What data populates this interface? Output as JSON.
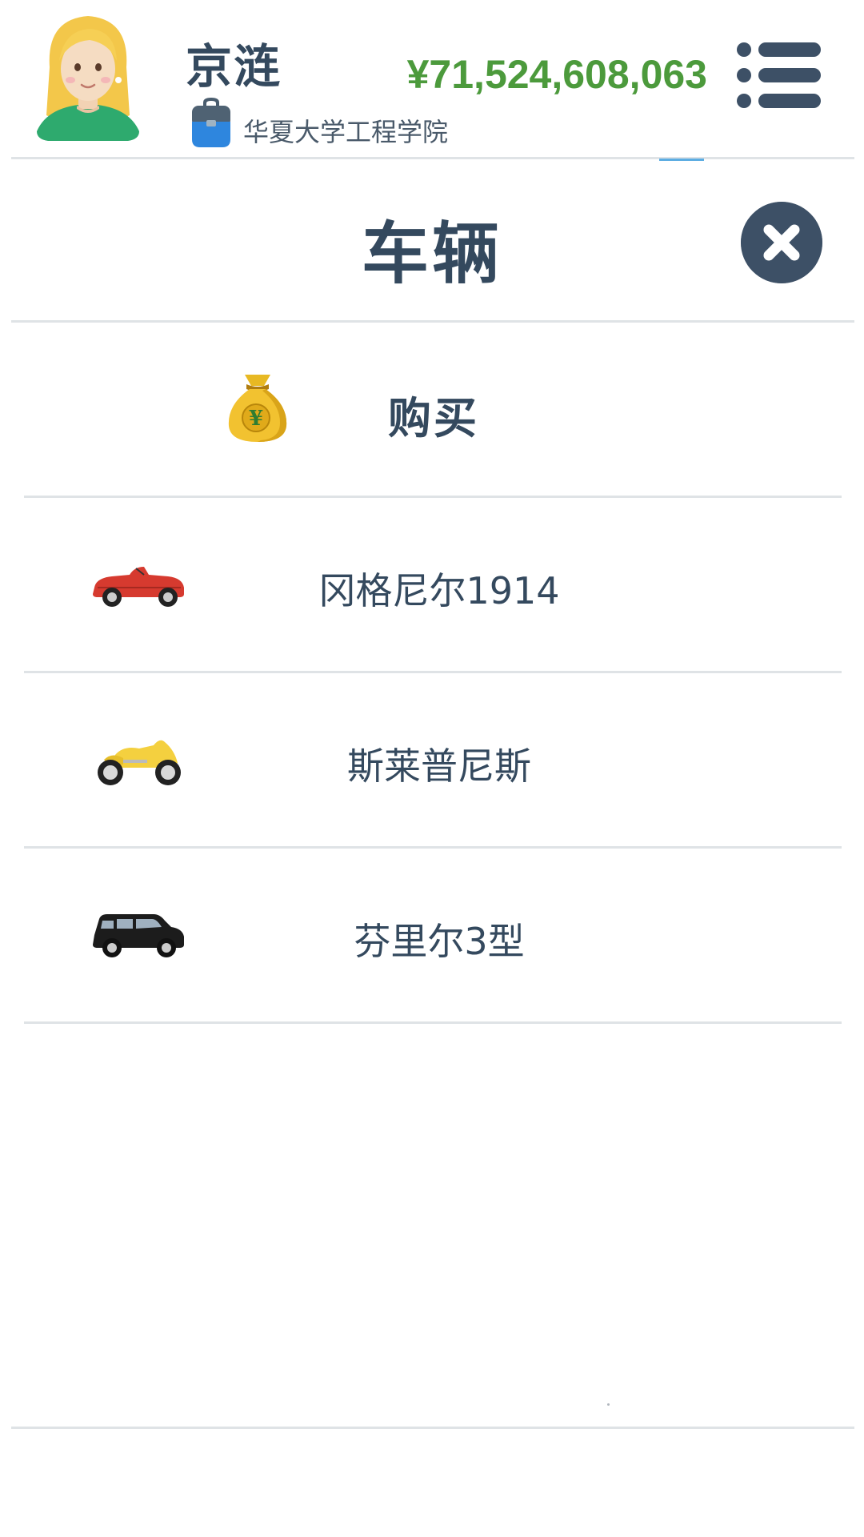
{
  "header": {
    "player_name": "京涟",
    "job": "华夏大学工程学院",
    "money": "¥71,524,608,063",
    "icons": {
      "avatar": "avatar-blonde-woman",
      "job": "school-bag-icon",
      "menu": "list-menu-icon"
    }
  },
  "panel": {
    "title": "车辆",
    "close_icon": "close-icon"
  },
  "buy": {
    "label": "购买",
    "icon": "money-bag-yuan-icon"
  },
  "vehicles": [
    {
      "label": "冈格尼尔1914",
      "icon": "red-convertible-car-icon"
    },
    {
      "label": "斯莱普尼斯",
      "icon": "yellow-motorcycle-icon"
    },
    {
      "label": "芬里尔3型",
      "icon": "black-suv-icon"
    }
  ],
  "colors": {
    "text": "#34495e",
    "money": "#4c9a3c",
    "divider": "#dfe3e6",
    "close_bg": "#3d5066"
  }
}
